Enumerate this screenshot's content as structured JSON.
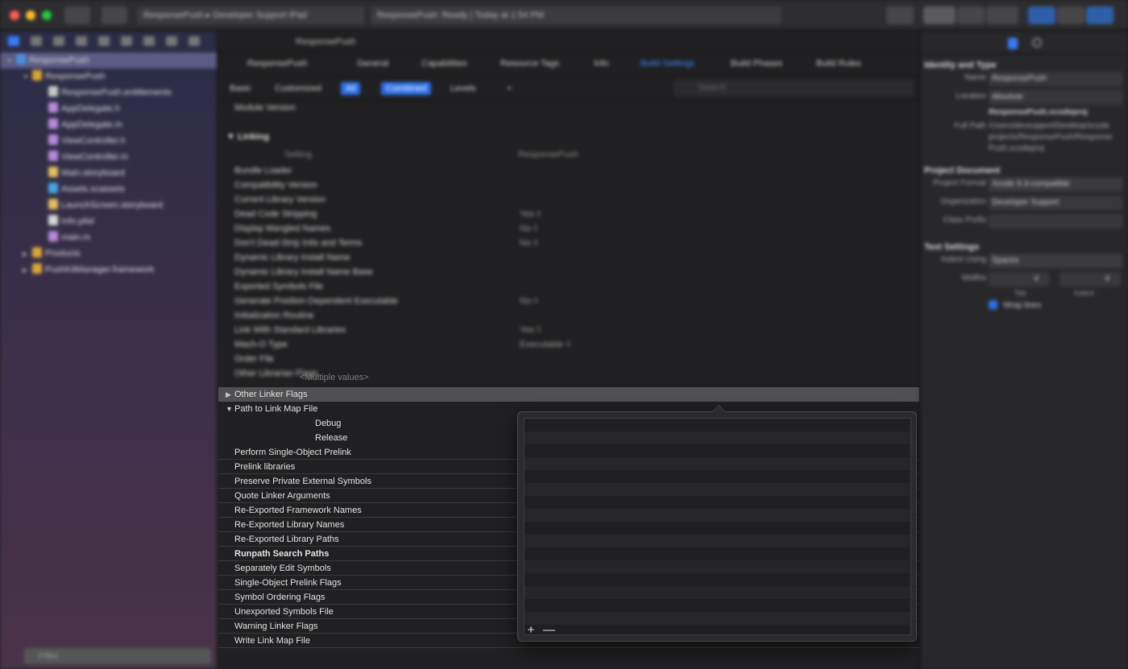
{
  "toolbar": {
    "scheme": "ResponsePush",
    "destination": "Developer Support iPad",
    "status": "ResponsePush: Ready | Today at 1:54 PM"
  },
  "navigator": {
    "items": [
      {
        "label": "ResponsePush",
        "icon": "project-icon",
        "level": 0,
        "selected": true
      },
      {
        "label": "ResponsePush",
        "icon": "folder-icon",
        "level": 1
      },
      {
        "label": "ResponsePush.entitlements",
        "icon": "file-icon",
        "level": 2
      },
      {
        "label": "AppDelegate.h",
        "icon": "header-file-icon",
        "level": 2
      },
      {
        "label": "AppDelegate.m",
        "icon": "source-file-icon",
        "level": 2
      },
      {
        "label": "ViewController.h",
        "icon": "header-file-icon",
        "level": 2
      },
      {
        "label": "ViewController.m",
        "icon": "source-file-icon",
        "level": 2
      },
      {
        "label": "Main.storyboard",
        "icon": "storyboard-icon",
        "level": 2
      },
      {
        "label": "Assets.xcassets",
        "icon": "assets-icon",
        "level": 2
      },
      {
        "label": "LaunchScreen.storyboard",
        "icon": "storyboard-icon",
        "level": 2
      },
      {
        "label": "Info.plist",
        "icon": "plist-icon",
        "level": 2
      },
      {
        "label": "main.m",
        "icon": "source-file-icon",
        "level": 2
      },
      {
        "label": "Products",
        "icon": "folder-icon",
        "level": 1
      },
      {
        "label": "PushKitManager.framework",
        "icon": "framework-icon",
        "level": 1
      }
    ],
    "filter_placeholder": "Filter"
  },
  "editor": {
    "jumpbar": "ResponsePush",
    "target": "ResponsePush",
    "tabs": [
      "General",
      "Capabilities",
      "Resource Tags",
      "Info",
      "Build Settings",
      "Build Phases",
      "Build Rules"
    ],
    "active_tab": "Build Settings",
    "filters": [
      "Basic",
      "Customized",
      "All",
      "Combined",
      "Levels",
      "+"
    ],
    "search_placeholder": "Search",
    "module_version_label": "Module Version",
    "linking_section": "Linking",
    "column_setting": "Setting",
    "column_target": "ResponsePush",
    "blurred_rows": [
      {
        "label": "Bundle Loader",
        "value": ""
      },
      {
        "label": "Compatibility Version",
        "value": ""
      },
      {
        "label": "Current Library Version",
        "value": ""
      },
      {
        "label": "Dead Code Stripping",
        "value": "Yes ◊"
      },
      {
        "label": "Display Mangled Names",
        "value": "No ◊"
      },
      {
        "label": "Don't Dead-Strip Inits and Terms",
        "value": "No ◊"
      },
      {
        "label": "Dynamic Library Install Name",
        "value": ""
      },
      {
        "label": "Dynamic Library Install Name Base",
        "value": ""
      },
      {
        "label": "Exported Symbols File",
        "value": ""
      },
      {
        "label": "Generate Position-Dependent Executable",
        "value": "No ◊"
      },
      {
        "label": "Initialization Routine",
        "value": ""
      },
      {
        "label": "Link With Standard Libraries",
        "value": "Yes ◊"
      },
      {
        "label": "Mach-O Type",
        "value": "Executable ◊"
      },
      {
        "label": "Order File",
        "value": ""
      },
      {
        "label": "Other Librarian Flags",
        "value": ""
      }
    ],
    "rows": [
      {
        "label": "Other Linker Flags",
        "disclosure": "▶",
        "highlight": true
      },
      {
        "label": "Path to Link Map File",
        "disclosure": "▼"
      },
      {
        "label": "Debug",
        "sub": true
      },
      {
        "label": "Release",
        "sub": true
      },
      {
        "label": "Perform Single-Object Prelink"
      },
      {
        "label": "Prelink libraries"
      },
      {
        "label": "Preserve Private External Symbols"
      },
      {
        "label": "Quote Linker Arguments"
      },
      {
        "label": "Re-Exported Framework Names"
      },
      {
        "label": "Re-Exported Library Names"
      },
      {
        "label": "Re-Exported Library Paths"
      },
      {
        "label": "Runpath Search Paths",
        "bold": true
      },
      {
        "label": "Separately Edit Symbols"
      },
      {
        "label": "Single-Object Prelink Flags"
      },
      {
        "label": "Symbol Ordering Flags"
      },
      {
        "label": "Unexported Symbols File"
      },
      {
        "label": "Warning Linker Flags"
      },
      {
        "label": "Write Link Map File"
      }
    ],
    "multiple_values": "<Multiple values>"
  },
  "popover": {
    "add_label": "+",
    "remove_label": "—"
  },
  "inspector": {
    "identity_header": "Identity and Type",
    "name_label": "Name",
    "name_value": "ResponsePush",
    "location_label": "Location",
    "location_value": "Absolute",
    "project_file": "ResponsePush.xcodeproj",
    "full_path_label": "Full Path",
    "full_path_value": "/Users/devsupport/Desktop/xcode projects/ResponsePush/ResponsePush.xcodeproj",
    "project_doc_header": "Project Document",
    "project_format_label": "Project Format",
    "project_format_value": "Xcode 9.3-compatible",
    "organization_label": "Organization",
    "organization_value": "Developer Support",
    "class_prefix_label": "Class Prefix",
    "text_settings_header": "Text Settings",
    "indent_using_label": "Indent Using",
    "indent_using_value": "Spaces",
    "widths_label": "Widths",
    "tab_label": "Tab",
    "indent_label": "Indent",
    "tab_value": "4",
    "indent_value": "4",
    "wrap_lines_label": "Wrap lines"
  },
  "colors": {
    "accent": "#2d6fe6",
    "active_tab": "#3a8cff",
    "highlight_row": "#505052"
  }
}
